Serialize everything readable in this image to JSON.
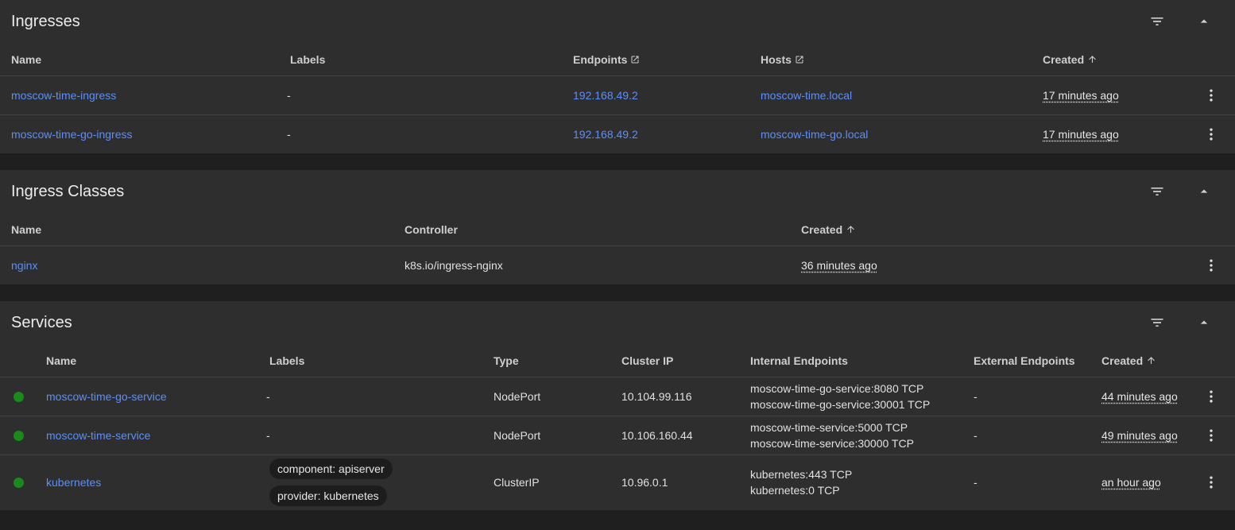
{
  "ingresses": {
    "title": "Ingresses",
    "columns": {
      "name": "Name",
      "labels": "Labels",
      "endpoints": "Endpoints",
      "hosts": "Hosts",
      "created": "Created"
    },
    "rows": [
      {
        "name": "moscow-time-ingress",
        "labels": "-",
        "endpoints": "192.168.49.2",
        "hosts": "moscow-time.local",
        "created": "17 minutes ago"
      },
      {
        "name": "moscow-time-go-ingress",
        "labels": "-",
        "endpoints": "192.168.49.2",
        "hosts": "moscow-time-go.local",
        "created": "17 minutes ago"
      }
    ]
  },
  "ingress_classes": {
    "title": "Ingress Classes",
    "columns": {
      "name": "Name",
      "controller": "Controller",
      "created": "Created"
    },
    "rows": [
      {
        "name": "nginx",
        "controller": "k8s.io/ingress-nginx",
        "created": "36 minutes ago"
      }
    ]
  },
  "services": {
    "title": "Services",
    "columns": {
      "name": "Name",
      "labels": "Labels",
      "type": "Type",
      "cluster_ip": "Cluster IP",
      "internal_endpoints": "Internal Endpoints",
      "external_endpoints": "External Endpoints",
      "created": "Created"
    },
    "rows": [
      {
        "status": "ready",
        "name": "moscow-time-go-service",
        "labels": "-",
        "type": "NodePort",
        "cluster_ip": "10.104.99.116",
        "internal_endpoints": [
          "moscow-time-go-service:8080 TCP",
          "moscow-time-go-service:30001 TCP"
        ],
        "external_endpoints": "-",
        "created": "44 minutes ago"
      },
      {
        "status": "ready",
        "name": "moscow-time-service",
        "labels": "-",
        "type": "NodePort",
        "cluster_ip": "10.106.160.44",
        "internal_endpoints": [
          "moscow-time-service:5000 TCP",
          "moscow-time-service:30000 TCP"
        ],
        "external_endpoints": "-",
        "created": "49 minutes ago"
      },
      {
        "status": "ready",
        "name": "kubernetes",
        "labels": [
          "component: apiserver",
          "provider: kubernetes"
        ],
        "type": "ClusterIP",
        "cluster_ip": "10.96.0.1",
        "internal_endpoints": [
          "kubernetes:443 TCP",
          "kubernetes:0 TCP"
        ],
        "external_endpoints": "-",
        "created": "an hour ago"
      }
    ]
  },
  "icons": {
    "filter": "filter-icon",
    "collapse": "chevron-up-icon",
    "external_link": "external-link-icon",
    "sort": "arrow-up-icon",
    "row_menu": "more-vert-icon",
    "status": "status-dot-icon"
  },
  "colors": {
    "link": "#5b8ff9",
    "status_ready": "#1a8a1a",
    "card_bg": "#2e2e2e",
    "page_bg": "#1f1f1f"
  }
}
